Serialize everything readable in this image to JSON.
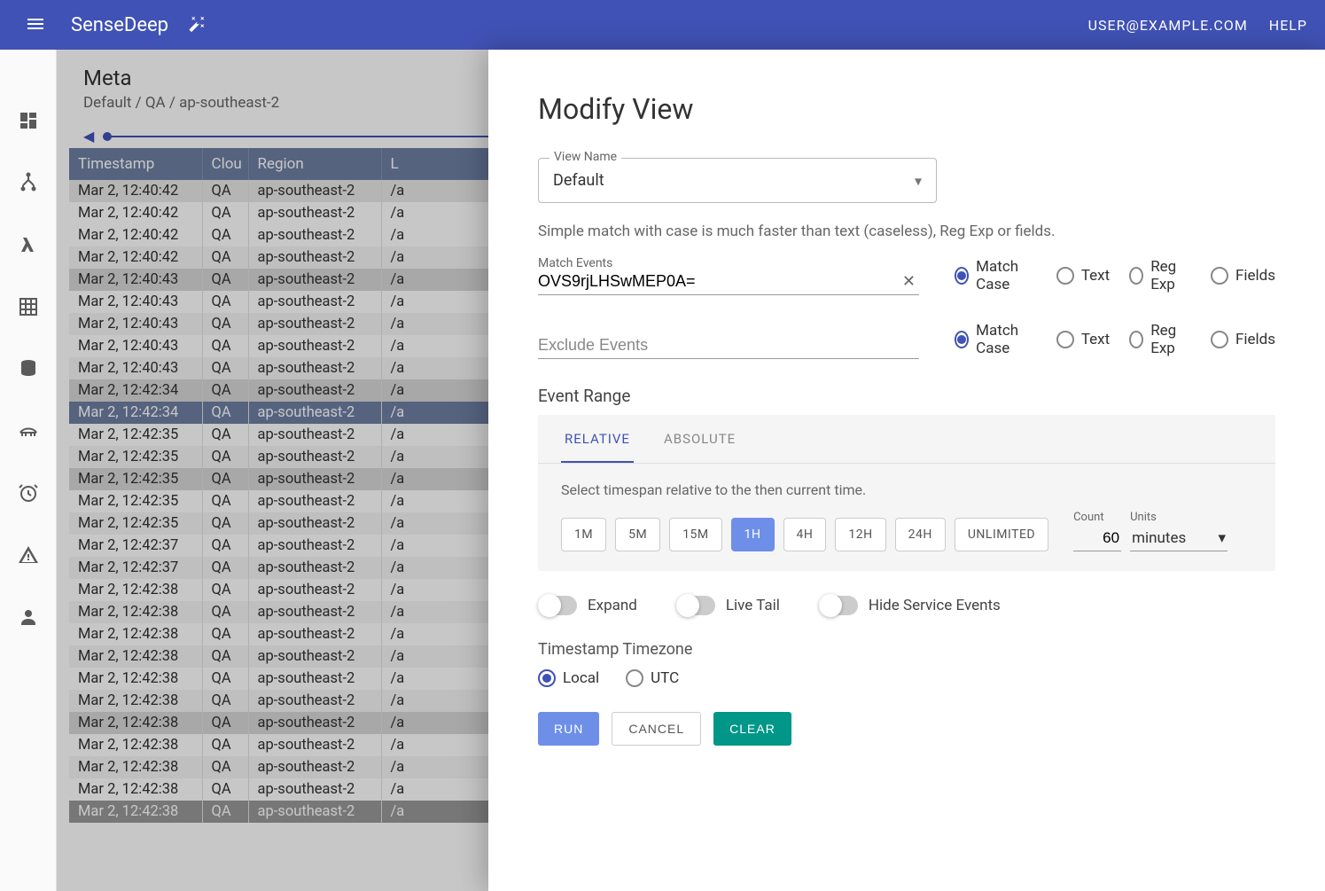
{
  "header": {
    "logo": "SenseDeep",
    "user": "USER@EXAMPLE.COM",
    "help": "HELP"
  },
  "page": {
    "title": "Meta",
    "breadcrumb": "Default / QA / ap-southeast-2"
  },
  "table": {
    "headers": [
      "Timestamp",
      "Clou",
      "Region",
      "L"
    ],
    "rows": [
      {
        "ts": "Mar 2, 12:40:42",
        "cloud": "QA",
        "region": "ap-southeast-2",
        "l": "/a",
        "cls": "shade"
      },
      {
        "ts": "Mar 2, 12:40:42",
        "cloud": "QA",
        "region": "ap-southeast-2",
        "l": "/a",
        "cls": "odd"
      },
      {
        "ts": "Mar 2, 12:40:42",
        "cloud": "QA",
        "region": "ap-southeast-2",
        "l": "/a",
        "cls": "odd"
      },
      {
        "ts": "Mar 2, 12:40:42",
        "cloud": "QA",
        "region": "ap-southeast-2",
        "l": "/a",
        "cls": "even"
      },
      {
        "ts": "Mar 2, 12:40:43",
        "cloud": "QA",
        "region": "ap-southeast-2",
        "l": "/a",
        "cls": "shade2"
      },
      {
        "ts": "Mar 2, 12:40:43",
        "cloud": "QA",
        "region": "ap-southeast-2",
        "l": "/a",
        "cls": "odd"
      },
      {
        "ts": "Mar 2, 12:40:43",
        "cloud": "QA",
        "region": "ap-southeast-2",
        "l": "/a",
        "cls": "even"
      },
      {
        "ts": "Mar 2, 12:40:43",
        "cloud": "QA",
        "region": "ap-southeast-2",
        "l": "/a",
        "cls": "odd"
      },
      {
        "ts": "Mar 2, 12:40:43",
        "cloud": "QA",
        "region": "ap-southeast-2",
        "l": "/a",
        "cls": "even"
      },
      {
        "ts": "Mar 2, 12:42:34",
        "cloud": "QA",
        "region": "ap-southeast-2",
        "l": "/a",
        "cls": "shade2"
      },
      {
        "ts": "Mar 2, 12:42:34",
        "cloud": "QA",
        "region": "ap-southeast-2",
        "l": "/a",
        "cls": "selected"
      },
      {
        "ts": "Mar 2, 12:42:35",
        "cloud": "QA",
        "region": "ap-southeast-2",
        "l": "/a",
        "cls": "odd"
      },
      {
        "ts": "Mar 2, 12:42:35",
        "cloud": "QA",
        "region": "ap-southeast-2",
        "l": "/a",
        "cls": "even"
      },
      {
        "ts": "Mar 2, 12:42:35",
        "cloud": "QA",
        "region": "ap-southeast-2",
        "l": "/a",
        "cls": "shade2"
      },
      {
        "ts": "Mar 2, 12:42:35",
        "cloud": "QA",
        "region": "ap-southeast-2",
        "l": "/a",
        "cls": "odd"
      },
      {
        "ts": "Mar 2, 12:42:35",
        "cloud": "QA",
        "region": "ap-southeast-2",
        "l": "/a",
        "cls": "even"
      },
      {
        "ts": "Mar 2, 12:42:37",
        "cloud": "QA",
        "region": "ap-southeast-2",
        "l": "/a",
        "cls": "odd"
      },
      {
        "ts": "Mar 2, 12:42:37",
        "cloud": "QA",
        "region": "ap-southeast-2",
        "l": "/a",
        "cls": "even"
      },
      {
        "ts": "Mar 2, 12:42:38",
        "cloud": "QA",
        "region": "ap-southeast-2",
        "l": "/a",
        "cls": "odd"
      },
      {
        "ts": "Mar 2, 12:42:38",
        "cloud": "QA",
        "region": "ap-southeast-2",
        "l": "/a",
        "cls": "even"
      },
      {
        "ts": "Mar 2, 12:42:38",
        "cloud": "QA",
        "region": "ap-southeast-2",
        "l": "/a",
        "cls": "odd"
      },
      {
        "ts": "Mar 2, 12:42:38",
        "cloud": "QA",
        "region": "ap-southeast-2",
        "l": "/a",
        "cls": "even"
      },
      {
        "ts": "Mar 2, 12:42:38",
        "cloud": "QA",
        "region": "ap-southeast-2",
        "l": "/a",
        "cls": "odd"
      },
      {
        "ts": "Mar 2, 12:42:38",
        "cloud": "QA",
        "region": "ap-southeast-2",
        "l": "/a",
        "cls": "even"
      },
      {
        "ts": "Mar 2, 12:42:38",
        "cloud": "QA",
        "region": "ap-southeast-2",
        "l": "/a",
        "cls": "shade2"
      },
      {
        "ts": "Mar 2, 12:42:38",
        "cloud": "QA",
        "region": "ap-southeast-2",
        "l": "/a",
        "cls": "odd"
      },
      {
        "ts": "Mar 2, 12:42:38",
        "cloud": "QA",
        "region": "ap-southeast-2",
        "l": "/a",
        "cls": "even"
      },
      {
        "ts": "Mar 2, 12:42:38",
        "cloud": "QA",
        "region": "ap-southeast-2",
        "l": "/a",
        "cls": "odd"
      },
      {
        "ts": "Mar 2, 12:42:38",
        "cloud": "QA",
        "region": "ap-southeast-2",
        "l": "/a",
        "cls": "dark"
      }
    ]
  },
  "panel": {
    "title": "Modify View",
    "viewName": {
      "label": "View Name",
      "value": "Default"
    },
    "hint": "Simple match with case is much faster than text (caseless), Reg Exp or fields.",
    "match": {
      "label": "Match Events",
      "value": "OVS9rjLHSwMEP0A="
    },
    "exclude": {
      "label": "Exclude Events",
      "value": ""
    },
    "radios": {
      "matchCase": "Match Case",
      "text": "Text",
      "regExp": "Reg Exp",
      "fields": "Fields"
    },
    "range": {
      "title": "Event Range",
      "tabs": {
        "relative": "RELATIVE",
        "absolute": "ABSOLUTE"
      },
      "hint": "Select timespan relative to the then current time.",
      "pills": [
        "1M",
        "5M",
        "15M",
        "1H",
        "4H",
        "12H",
        "24H",
        "UNLIMITED"
      ],
      "activePill": 3,
      "count": {
        "label": "Count",
        "value": "60"
      },
      "units": {
        "label": "Units",
        "value": "minutes"
      }
    },
    "toggles": {
      "expand": "Expand",
      "liveTail": "Live Tail",
      "hideService": "Hide Service Events"
    },
    "tz": {
      "title": "Timestamp Timezone",
      "local": "Local",
      "utc": "UTC"
    },
    "buttons": {
      "run": "RUN",
      "cancel": "CANCEL",
      "clear": "CLEAR"
    }
  }
}
